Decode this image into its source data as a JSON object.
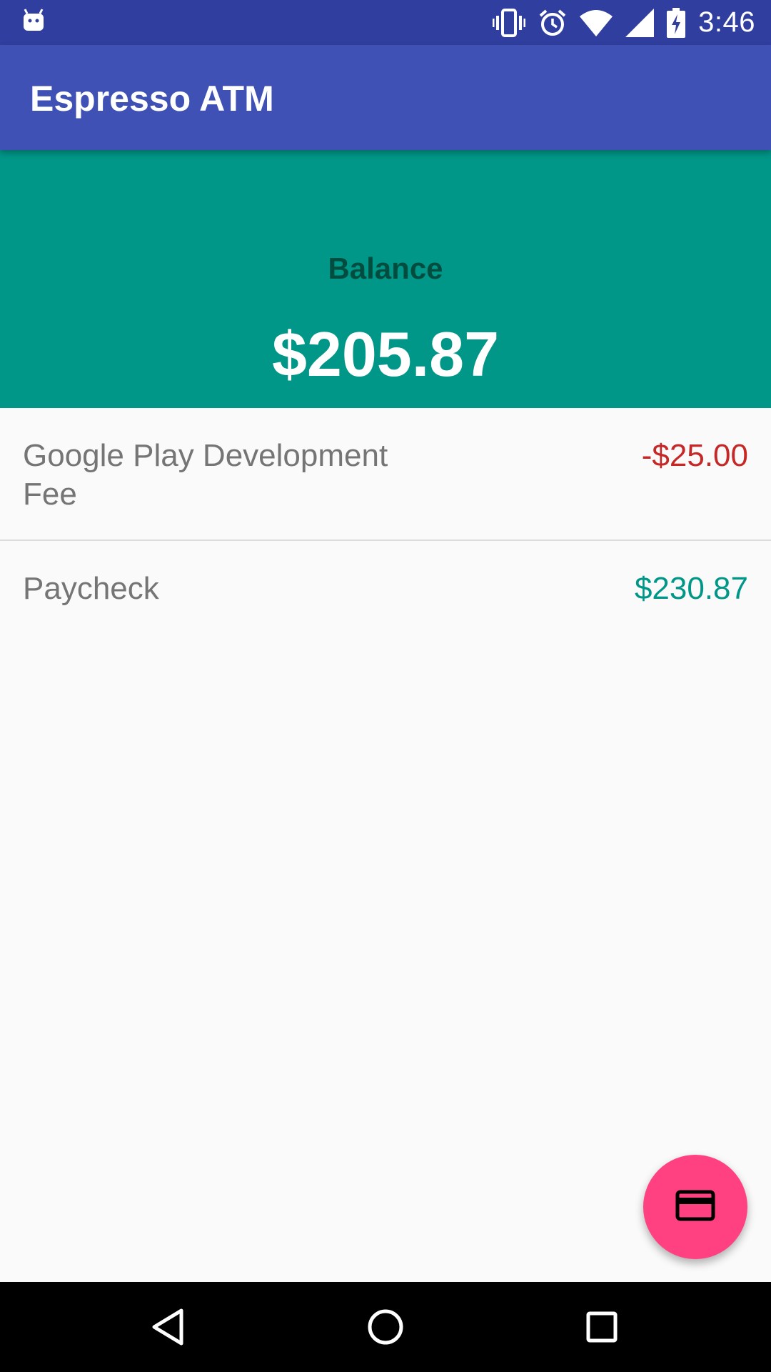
{
  "status_bar": {
    "time": "3:46",
    "icons": [
      "android-notification-icon",
      "vibrate-icon",
      "alarm-icon",
      "wifi-icon",
      "cell-signal-icon",
      "battery-charging-icon"
    ]
  },
  "app_bar": {
    "title": "Espresso ATM"
  },
  "balance": {
    "label": "Balance",
    "amount": "$205.87"
  },
  "transactions": [
    {
      "description": "Google Play Development Fee",
      "amount": "-$25.00",
      "type": "debit"
    },
    {
      "description": "Paycheck",
      "amount": "$230.87",
      "type": "credit"
    }
  ],
  "fab": {
    "icon": "credit-card-icon"
  },
  "nav_bar": {
    "buttons": [
      "back-icon",
      "home-icon",
      "recents-icon"
    ]
  },
  "colors": {
    "status_bar": "#303f9f",
    "app_bar": "#3f51b5",
    "balance_panel": "#009688",
    "debit": "#c62828",
    "credit": "#009688",
    "fab": "#ff4081"
  }
}
